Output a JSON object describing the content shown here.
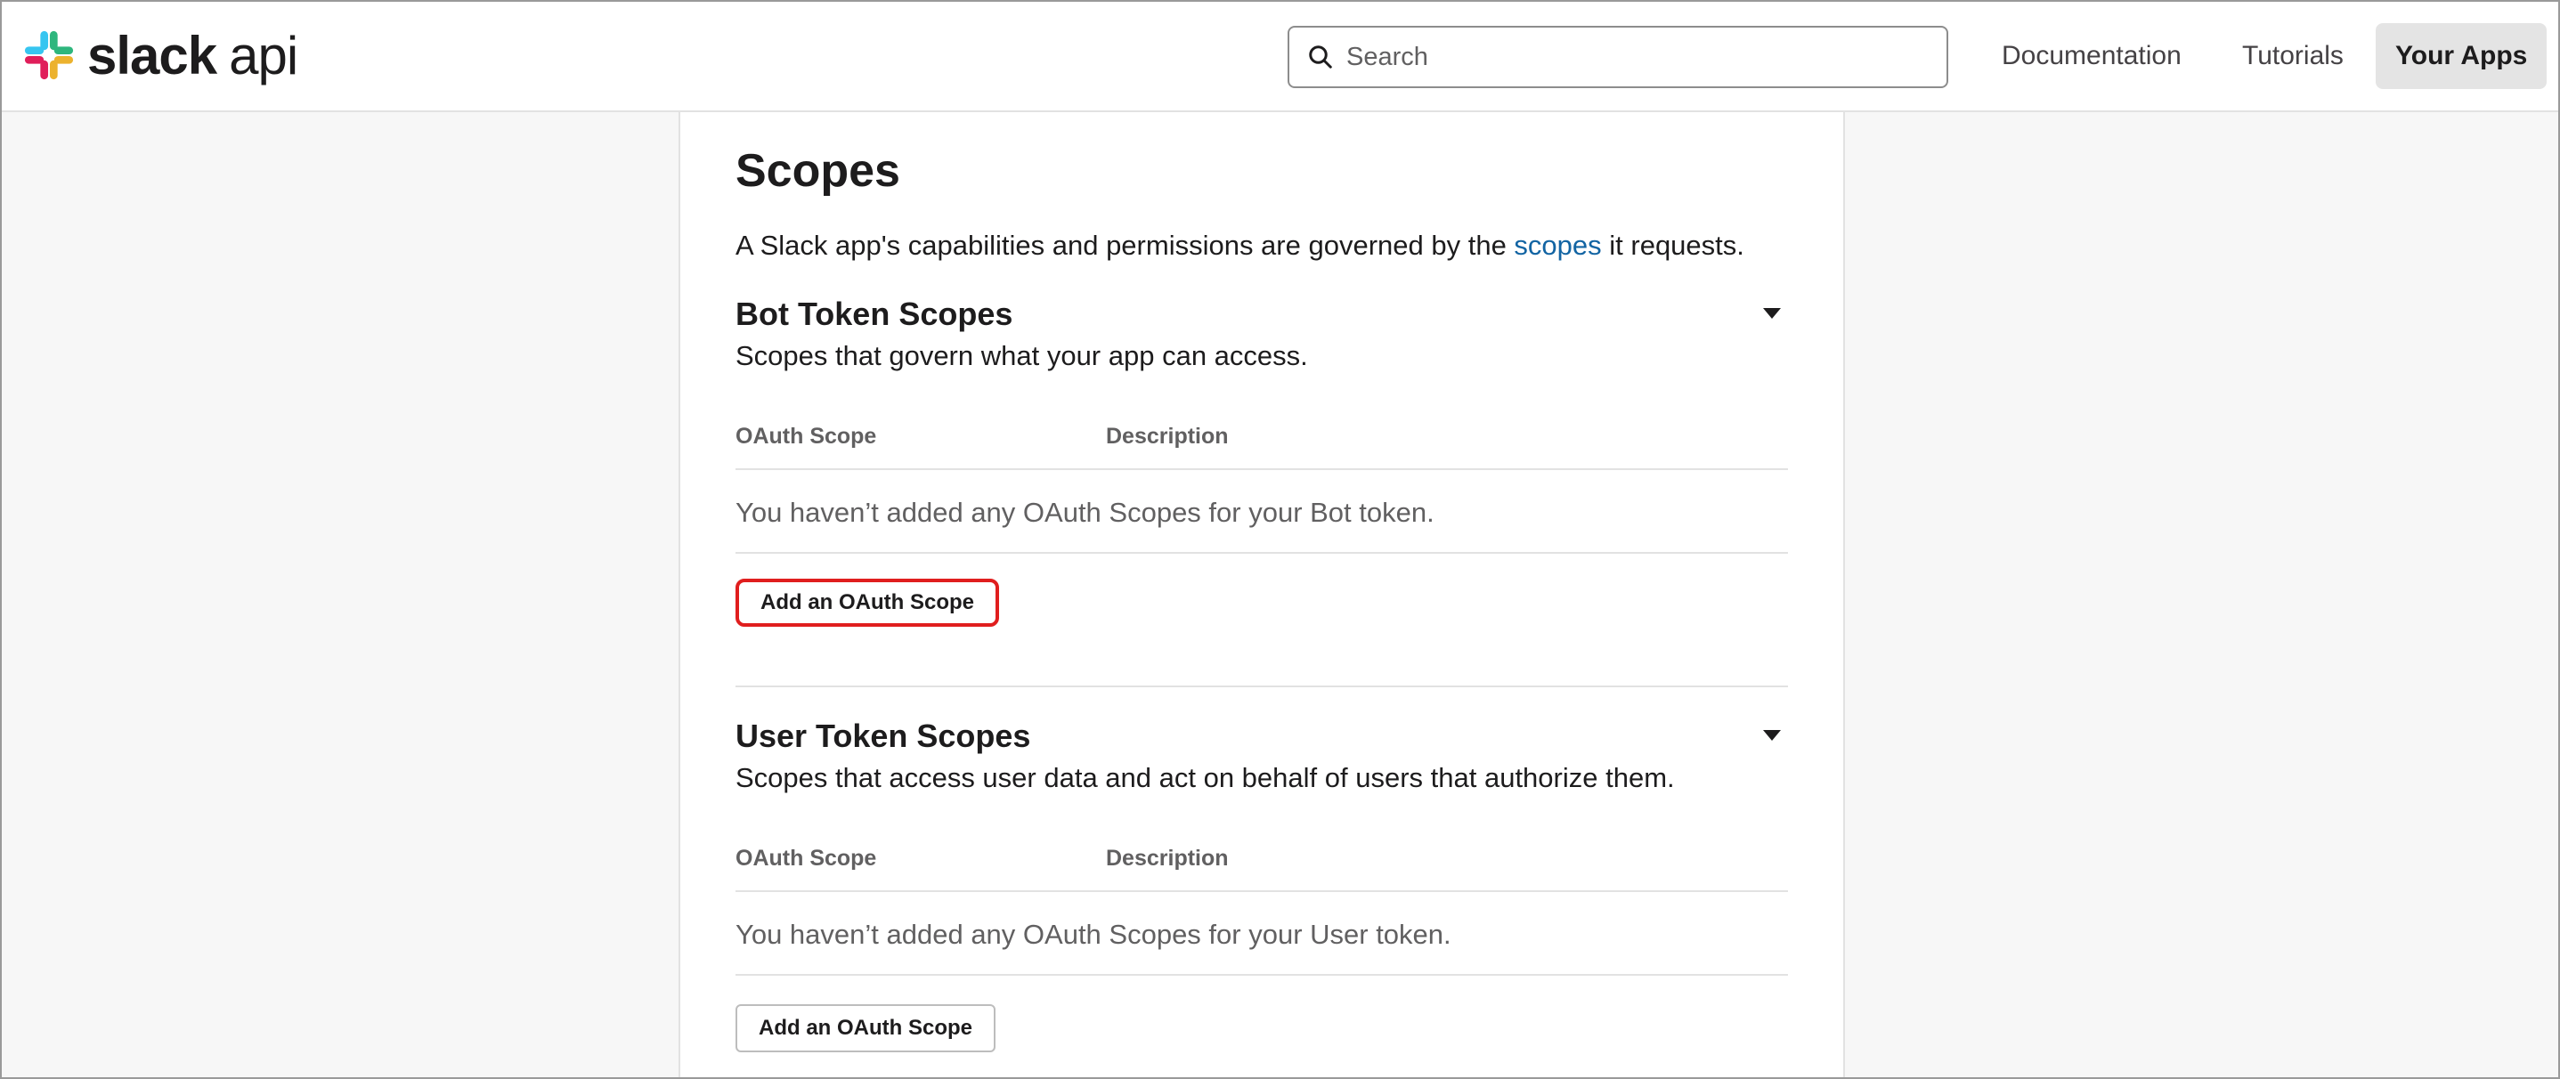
{
  "header": {
    "logo_word": "slack",
    "logo_suffix": "api",
    "search_placeholder": "Search",
    "nav": {
      "documentation": "Documentation",
      "tutorials": "Tutorials",
      "your_apps": "Your Apps"
    }
  },
  "page": {
    "title": "Scopes",
    "intro_before": "A Slack app's capabilities and permissions are governed by the ",
    "intro_link": "scopes",
    "intro_after": " it requests."
  },
  "bot_section": {
    "title": "Bot Token Scopes",
    "description": "Scopes that govern what your app can access.",
    "col_scope": "OAuth Scope",
    "col_description": "Description",
    "empty_text": "You haven’t added any OAuth Scopes for your Bot token.",
    "button_label": "Add an OAuth Scope"
  },
  "user_section": {
    "title": "User Token Scopes",
    "description": "Scopes that access user data and act on behalf of users that authorize them.",
    "col_scope": "OAuth Scope",
    "col_description": "Description",
    "empty_text": "You haven’t added any OAuth Scopes for your User token.",
    "button_label": "Add an OAuth Scope"
  },
  "colors": {
    "link": "#1264a3",
    "highlight": "#e01e1e",
    "logo_blue": "#36c5f0",
    "logo_green": "#2eb67d",
    "logo_yellow": "#ecb22e",
    "logo_red": "#e01e5a"
  }
}
